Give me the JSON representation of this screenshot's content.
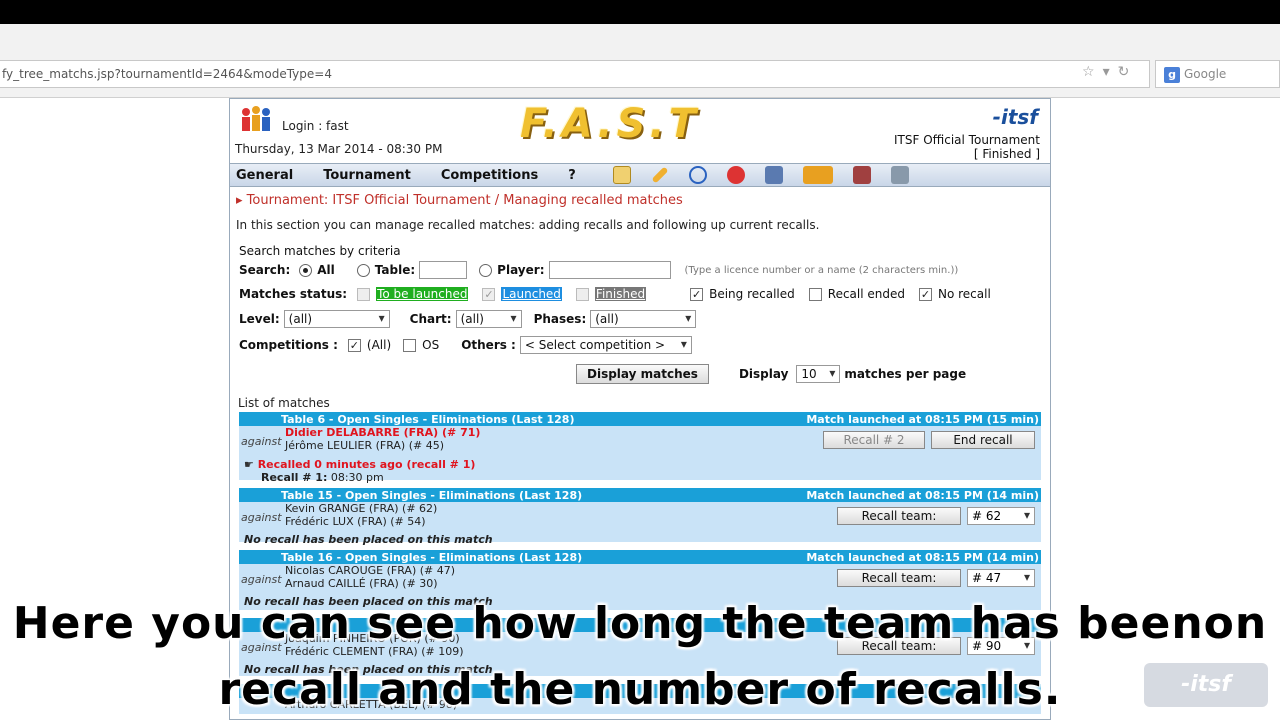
{
  "browser": {
    "url": "fy_tree_matchs.jsp?tournamentId=2464&modeType=4",
    "search_engine": "Google",
    "search_icon": "google-g-icon"
  },
  "header": {
    "login": "Login : fast",
    "datetime": "Thursday, 13 Mar 2014 - 08:30 PM",
    "logo_text": "F.A.S.T",
    "org_logo": "-itsf",
    "tournament_name": "ITSF Official Tournament",
    "tournament_status": "[ Finished ]"
  },
  "nav": {
    "items": [
      "General",
      "Tournament",
      "Competitions",
      "?"
    ],
    "icons": [
      "home-icon",
      "pencil-icon",
      "search-icon",
      "players-icon",
      "table-swap-icon",
      "transfer-icon",
      "foosball-table-icon",
      "screens-icon"
    ]
  },
  "breadcrumb": "Tournament: ITSF Official Tournament / Managing recalled matches",
  "intro": "In this section you can manage recalled matches: adding recalls and following up current recalls.",
  "search": {
    "section_label": "Search matches by criteria",
    "label": "Search:",
    "opt_all": "All",
    "opt_table": "Table:",
    "opt_player": "Player:",
    "hint": "(Type a licence number or a name (2 characters min.))",
    "status_label": "Matches status:",
    "status_to_be_launched": "To be launched",
    "status_launched": "Launched",
    "status_finished": "Finished",
    "being_recalled": "Being recalled",
    "recall_ended": "Recall ended",
    "no_recall": "No recall",
    "level_label": "Level:",
    "level_value": "(all)",
    "chart_label": "Chart:",
    "chart_value": "(all)",
    "phases_label": "Phases:",
    "phases_value": "(all)",
    "competitions_label": "Competitions :",
    "comp_all": "(All)",
    "comp_os": "OS",
    "others_label": "Others :",
    "others_value": "< Select competition >",
    "display_button": "Display matches",
    "display_label": "Display",
    "per_page_value": "10",
    "per_page_label": "matches per page"
  },
  "list_title": "List of matches",
  "matches": [
    {
      "title": "Table 6 - Open Singles - Eliminations (Last 128)",
      "launched": "Match launched at 08:15 PM (15 min)",
      "against": "against",
      "player1": "Didier DELABARRE (FRA) (# 71)",
      "player2": "Jérôme LEULIER (FRA) (# 45)",
      "recalled": "Recalled 0 minutes ago (recall # 1)",
      "recall_label": "Recall # 1:",
      "recall_time": "08:30 pm",
      "btn_recall": "Recall # 2",
      "btn_end": "End recall"
    },
    {
      "title": "Table 15 - Open Singles - Eliminations (Last 128)",
      "launched": "Match launched at 08:15 PM (14 min)",
      "against": "against",
      "player1": "Kevin GRANGE (FRA) (# 62)",
      "player2": "Frédéric LUX (FRA) (# 54)",
      "note": "No recall has been placed on this match",
      "btn_recall": "Recall team:",
      "team_value": "# 62"
    },
    {
      "title": "Table 16 - Open Singles - Eliminations (Last 128)",
      "launched": "Match launched at 08:15 PM (14 min)",
      "against": "against",
      "player1": "Nicolas CAROUGE (FRA) (# 47)",
      "player2": "Arnaud CAILLÉ (FRA) (# 30)",
      "note": "No recall has been placed on this match",
      "btn_recall": "Recall team:",
      "team_value": "# 47"
    },
    {
      "title": "",
      "launched": "",
      "against": "against",
      "player1": "Joaquim PINHEIRO (POR) (# 90)",
      "player2": "Frédéric CLEMENT (FRA) (# 109)",
      "note": "No recall has been placed on this match",
      "btn_recall": "Recall team:",
      "team_value": "# 90"
    },
    {
      "title": "",
      "launched": "",
      "player1": "Arthuro CARLETTA (BEL) (# 98)"
    }
  ],
  "caption": {
    "line1": "Here you can see how long the team has beenon",
    "line2": "recall and the number of recalls."
  },
  "watermark": "-itsf"
}
